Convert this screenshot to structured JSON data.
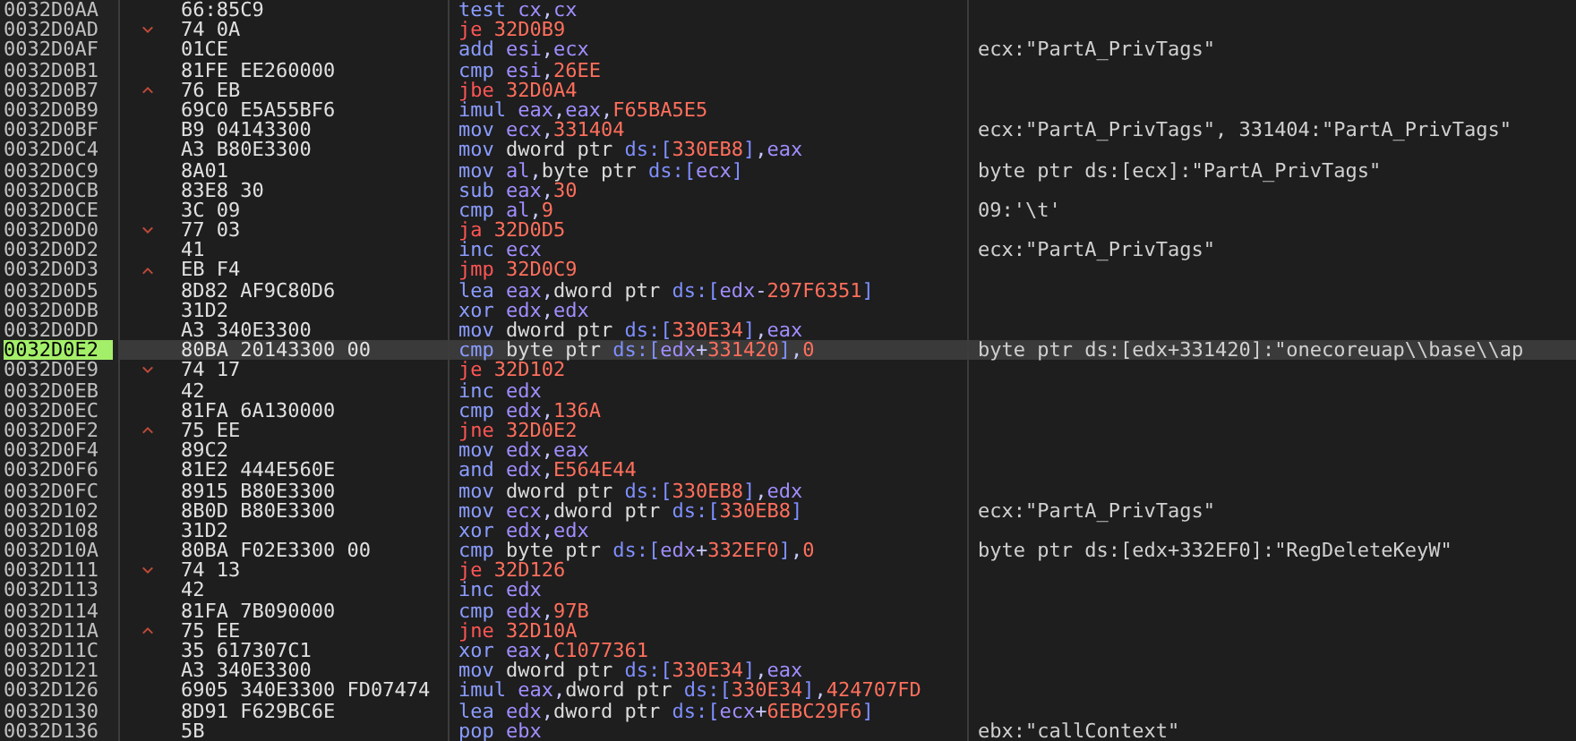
{
  "rows": [
    {
      "address": "0032D0AA",
      "kind": "plain",
      "bytes": "66:85C9",
      "mnemonic": "test",
      "operands": [
        {
          "text": "cx",
          "kind": "register"
        },
        {
          "text": ",",
          "kind": "punct"
        },
        {
          "text": "cx",
          "kind": "register"
        }
      ],
      "selected": false
    },
    {
      "address": "0032D0AD",
      "kind": "jump_down",
      "bytes": "74 0A",
      "mnemonic": "je",
      "operands": [
        {
          "text": "32D0B9",
          "kind": "number"
        }
      ],
      "selected": false
    },
    {
      "address": "0032D0AF",
      "kind": "plain",
      "bytes": "01CE",
      "mnemonic": "add",
      "operands": [
        {
          "text": "esi",
          "kind": "register"
        },
        {
          "text": ",",
          "kind": "punct"
        },
        {
          "text": "ecx",
          "kind": "register"
        }
      ],
      "comment": "ecx:\"PartA_PrivTags\"",
      "selected": false
    },
    {
      "address": "0032D0B1",
      "kind": "plain",
      "bytes": "81FE EE260000",
      "mnemonic": "cmp",
      "operands": [
        {
          "text": "esi",
          "kind": "register"
        },
        {
          "text": ",",
          "kind": "punct"
        },
        {
          "text": "26EE",
          "kind": "number"
        }
      ],
      "selected": false
    },
    {
      "address": "0032D0B7",
      "kind": "jump_up",
      "bytes": "76 EB",
      "mnemonic": "jbe",
      "operands": [
        {
          "text": "32D0A4",
          "kind": "number"
        }
      ],
      "selected": false
    },
    {
      "address": "0032D0B9",
      "kind": "plain",
      "bytes": "69C0 E5A55BF6",
      "mnemonic": "imul",
      "operands": [
        {
          "text": "eax",
          "kind": "register"
        },
        {
          "text": ",",
          "kind": "punct"
        },
        {
          "text": "eax",
          "kind": "register"
        },
        {
          "text": ",",
          "kind": "punct"
        },
        {
          "text": "F65BA5E5",
          "kind": "number"
        }
      ],
      "selected": false
    },
    {
      "address": "0032D0BF",
      "kind": "plain",
      "bytes": "B9 04143300",
      "mnemonic": "mov",
      "operands": [
        {
          "text": "ecx",
          "kind": "register"
        },
        {
          "text": ",",
          "kind": "punct"
        },
        {
          "text": "331404",
          "kind": "number"
        }
      ],
      "comment": "ecx:\"PartA_PrivTags\", 331404:\"PartA_PrivTags\"",
      "selected": false
    },
    {
      "address": "0032D0C4",
      "kind": "plain",
      "bytes": "A3 B80E3300",
      "mnemonic": "mov",
      "operands": [
        {
          "text": "dword ptr ",
          "kind": "size"
        },
        {
          "text": "ds:",
          "kind": "segment"
        },
        {
          "text": "[",
          "kind": "segment"
        },
        {
          "text": "330EB8",
          "kind": "number"
        },
        {
          "text": "]",
          "kind": "segment"
        },
        {
          "text": ",",
          "kind": "punct"
        },
        {
          "text": "eax",
          "kind": "register"
        }
      ],
      "selected": false
    },
    {
      "address": "0032D0C9",
      "kind": "plain",
      "bytes": "8A01",
      "mnemonic": "mov",
      "operands": [
        {
          "text": "al",
          "kind": "register"
        },
        {
          "text": ",",
          "kind": "punct"
        },
        {
          "text": "byte ptr ",
          "kind": "size"
        },
        {
          "text": "ds:",
          "kind": "segment"
        },
        {
          "text": "[",
          "kind": "segment"
        },
        {
          "text": "ecx",
          "kind": "register"
        },
        {
          "text": "]",
          "kind": "segment"
        }
      ],
      "comment": "byte ptr ds:[ecx]:\"PartA_PrivTags\"",
      "selected": false
    },
    {
      "address": "0032D0CB",
      "kind": "plain",
      "bytes": "83E8 30",
      "mnemonic": "sub",
      "operands": [
        {
          "text": "eax",
          "kind": "register"
        },
        {
          "text": ",",
          "kind": "punct"
        },
        {
          "text": "30",
          "kind": "number"
        }
      ],
      "selected": false
    },
    {
      "address": "0032D0CE",
      "kind": "plain",
      "bytes": "3C 09",
      "mnemonic": "cmp",
      "operands": [
        {
          "text": "al",
          "kind": "register"
        },
        {
          "text": ",",
          "kind": "punct"
        },
        {
          "text": "9",
          "kind": "number"
        }
      ],
      "comment": "09:'\\t'",
      "selected": false
    },
    {
      "address": "0032D0D0",
      "kind": "jump_down",
      "bytes": "77 03",
      "mnemonic": "ja",
      "operands": [
        {
          "text": "32D0D5",
          "kind": "number"
        }
      ],
      "selected": false
    },
    {
      "address": "0032D0D2",
      "kind": "plain",
      "bytes": "41",
      "mnemonic": "inc",
      "operands": [
        {
          "text": "ecx",
          "kind": "register"
        }
      ],
      "comment": "ecx:\"PartA_PrivTags\"",
      "selected": false
    },
    {
      "address": "0032D0D3",
      "kind": "jump_up",
      "bytes": "EB F4",
      "mnemonic": "jmp",
      "operands": [
        {
          "text": "32D0C9",
          "kind": "number"
        }
      ],
      "selected": false
    },
    {
      "address": "0032D0D5",
      "kind": "plain",
      "bytes": "8D82 AF9C80D6",
      "mnemonic": "lea",
      "operands": [
        {
          "text": "eax",
          "kind": "register"
        },
        {
          "text": ",",
          "kind": "punct"
        },
        {
          "text": "dword ptr ",
          "kind": "size"
        },
        {
          "text": "ds:",
          "kind": "segment"
        },
        {
          "text": "[",
          "kind": "segment"
        },
        {
          "text": "edx",
          "kind": "register"
        },
        {
          "text": "-",
          "kind": "punct"
        },
        {
          "text": "297F6351",
          "kind": "number"
        },
        {
          "text": "]",
          "kind": "segment"
        }
      ],
      "selected": false
    },
    {
      "address": "0032D0DB",
      "kind": "plain",
      "bytes": "31D2",
      "mnemonic": "xor",
      "operands": [
        {
          "text": "edx",
          "kind": "register"
        },
        {
          "text": ",",
          "kind": "punct"
        },
        {
          "text": "edx",
          "kind": "register"
        }
      ],
      "selected": false
    },
    {
      "address": "0032D0DD",
      "kind": "plain",
      "bytes": "A3 340E3300",
      "mnemonic": "mov",
      "operands": [
        {
          "text": "dword ptr ",
          "kind": "size"
        },
        {
          "text": "ds:",
          "kind": "segment"
        },
        {
          "text": "[",
          "kind": "segment"
        },
        {
          "text": "330E34",
          "kind": "number"
        },
        {
          "text": "]",
          "kind": "segment"
        },
        {
          "text": ",",
          "kind": "punct"
        },
        {
          "text": "eax",
          "kind": "register"
        }
      ],
      "selected": false
    },
    {
      "address": "0032D0E2",
      "kind": "plain",
      "bytes": "80BA 20143300 00",
      "mnemonic": "cmp",
      "operands": [
        {
          "text": "byte ptr ",
          "kind": "size"
        },
        {
          "text": "ds:",
          "kind": "segment"
        },
        {
          "text": "[",
          "kind": "segment"
        },
        {
          "text": "edx",
          "kind": "register"
        },
        {
          "text": "+",
          "kind": "punct"
        },
        {
          "text": "331420",
          "kind": "number"
        },
        {
          "text": "]",
          "kind": "segment"
        },
        {
          "text": ",",
          "kind": "punct"
        },
        {
          "text": "0",
          "kind": "number"
        }
      ],
      "comment": "byte ptr ds:[edx+331420]:\"onecoreuap\\\\base\\\\ap",
      "selected": true
    },
    {
      "address": "0032D0E9",
      "kind": "jump_down",
      "bytes": "74 17",
      "mnemonic": "je",
      "operands": [
        {
          "text": "32D102",
          "kind": "number"
        }
      ],
      "selected": false
    },
    {
      "address": "0032D0EB",
      "kind": "plain",
      "bytes": "42",
      "mnemonic": "inc",
      "operands": [
        {
          "text": "edx",
          "kind": "register"
        }
      ],
      "selected": false
    },
    {
      "address": "0032D0EC",
      "kind": "plain",
      "bytes": "81FA 6A130000",
      "mnemonic": "cmp",
      "operands": [
        {
          "text": "edx",
          "kind": "register"
        },
        {
          "text": ",",
          "kind": "punct"
        },
        {
          "text": "136A",
          "kind": "number"
        }
      ],
      "selected": false
    },
    {
      "address": "0032D0F2",
      "kind": "jump_up",
      "bytes": "75 EE",
      "mnemonic": "jne",
      "operands": [
        {
          "text": "32D0E2",
          "kind": "number"
        }
      ],
      "selected": false
    },
    {
      "address": "0032D0F4",
      "kind": "plain",
      "bytes": "89C2",
      "mnemonic": "mov",
      "operands": [
        {
          "text": "edx",
          "kind": "register"
        },
        {
          "text": ",",
          "kind": "punct"
        },
        {
          "text": "eax",
          "kind": "register"
        }
      ],
      "selected": false
    },
    {
      "address": "0032D0F6",
      "kind": "plain",
      "bytes": "81E2 444E560E",
      "mnemonic": "and",
      "operands": [
        {
          "text": "edx",
          "kind": "register"
        },
        {
          "text": ",",
          "kind": "punct"
        },
        {
          "text": "E564E44",
          "kind": "number"
        }
      ],
      "selected": false
    },
    {
      "address": "0032D0FC",
      "kind": "plain",
      "bytes": "8915 B80E3300",
      "mnemonic": "mov",
      "operands": [
        {
          "text": "dword ptr ",
          "kind": "size"
        },
        {
          "text": "ds:",
          "kind": "segment"
        },
        {
          "text": "[",
          "kind": "segment"
        },
        {
          "text": "330EB8",
          "kind": "number"
        },
        {
          "text": "]",
          "kind": "segment"
        },
        {
          "text": ",",
          "kind": "punct"
        },
        {
          "text": "edx",
          "kind": "register"
        }
      ],
      "selected": false
    },
    {
      "address": "0032D102",
      "kind": "plain",
      "bytes": "8B0D B80E3300",
      "mnemonic": "mov",
      "operands": [
        {
          "text": "ecx",
          "kind": "register"
        },
        {
          "text": ",",
          "kind": "punct"
        },
        {
          "text": "dword ptr ",
          "kind": "size"
        },
        {
          "text": "ds:",
          "kind": "segment"
        },
        {
          "text": "[",
          "kind": "segment"
        },
        {
          "text": "330EB8",
          "kind": "number"
        },
        {
          "text": "]",
          "kind": "segment"
        }
      ],
      "comment": "ecx:\"PartA_PrivTags\"",
      "selected": false
    },
    {
      "address": "0032D108",
      "kind": "plain",
      "bytes": "31D2",
      "mnemonic": "xor",
      "operands": [
        {
          "text": "edx",
          "kind": "register"
        },
        {
          "text": ",",
          "kind": "punct"
        },
        {
          "text": "edx",
          "kind": "register"
        }
      ],
      "selected": false
    },
    {
      "address": "0032D10A",
      "kind": "plain",
      "bytes": "80BA F02E3300 00",
      "mnemonic": "cmp",
      "operands": [
        {
          "text": "byte ptr ",
          "kind": "size"
        },
        {
          "text": "ds:",
          "kind": "segment"
        },
        {
          "text": "[",
          "kind": "segment"
        },
        {
          "text": "edx",
          "kind": "register"
        },
        {
          "text": "+",
          "kind": "punct"
        },
        {
          "text": "332EF0",
          "kind": "number"
        },
        {
          "text": "]",
          "kind": "segment"
        },
        {
          "text": ",",
          "kind": "punct"
        },
        {
          "text": "0",
          "kind": "number"
        }
      ],
      "comment": "byte ptr ds:[edx+332EF0]:\"RegDeleteKeyW\"",
      "selected": false
    },
    {
      "address": "0032D111",
      "kind": "jump_down",
      "bytes": "74 13",
      "mnemonic": "je",
      "operands": [
        {
          "text": "32D126",
          "kind": "number"
        }
      ],
      "selected": false
    },
    {
      "address": "0032D113",
      "kind": "plain",
      "bytes": "42",
      "mnemonic": "inc",
      "operands": [
        {
          "text": "edx",
          "kind": "register"
        }
      ],
      "selected": false
    },
    {
      "address": "0032D114",
      "kind": "plain",
      "bytes": "81FA 7B090000",
      "mnemonic": "cmp",
      "operands": [
        {
          "text": "edx",
          "kind": "register"
        },
        {
          "text": ",",
          "kind": "punct"
        },
        {
          "text": "97B",
          "kind": "number"
        }
      ],
      "selected": false
    },
    {
      "address": "0032D11A",
      "kind": "jump_up",
      "bytes": "75 EE",
      "mnemonic": "jne",
      "operands": [
        {
          "text": "32D10A",
          "kind": "number"
        }
      ],
      "selected": false
    },
    {
      "address": "0032D11C",
      "kind": "plain",
      "bytes": "35 617307C1",
      "mnemonic": "xor",
      "operands": [
        {
          "text": "eax",
          "kind": "register"
        },
        {
          "text": ",",
          "kind": "punct"
        },
        {
          "text": "C1077361",
          "kind": "number"
        }
      ],
      "selected": false
    },
    {
      "address": "0032D121",
      "kind": "plain",
      "bytes": "A3 340E3300",
      "mnemonic": "mov",
      "operands": [
        {
          "text": "dword ptr ",
          "kind": "size"
        },
        {
          "text": "ds:",
          "kind": "segment"
        },
        {
          "text": "[",
          "kind": "segment"
        },
        {
          "text": "330E34",
          "kind": "number"
        },
        {
          "text": "]",
          "kind": "segment"
        },
        {
          "text": ",",
          "kind": "punct"
        },
        {
          "text": "eax",
          "kind": "register"
        }
      ],
      "selected": false
    },
    {
      "address": "0032D126",
      "kind": "plain",
      "bytes": "6905 340E3300 FD07474",
      "mnemonic": "imul",
      "operands": [
        {
          "text": "eax",
          "kind": "register"
        },
        {
          "text": ",",
          "kind": "punct"
        },
        {
          "text": "dword ptr ",
          "kind": "size"
        },
        {
          "text": "ds:",
          "kind": "segment"
        },
        {
          "text": "[",
          "kind": "segment"
        },
        {
          "text": "330E34",
          "kind": "number"
        },
        {
          "text": "]",
          "kind": "segment"
        },
        {
          "text": ",",
          "kind": "punct"
        },
        {
          "text": "424707FD",
          "kind": "number"
        }
      ],
      "selected": false
    },
    {
      "address": "0032D130",
      "kind": "plain",
      "bytes": "8D91 F629BC6E",
      "mnemonic": "lea",
      "operands": [
        {
          "text": "edx",
          "kind": "register"
        },
        {
          "text": ",",
          "kind": "punct"
        },
        {
          "text": "dword ptr ",
          "kind": "size"
        },
        {
          "text": "ds:",
          "kind": "segment"
        },
        {
          "text": "[",
          "kind": "segment"
        },
        {
          "text": "ecx",
          "kind": "register"
        },
        {
          "text": "+",
          "kind": "punct"
        },
        {
          "text": "6EBC29F6",
          "kind": "number"
        },
        {
          "text": "]",
          "kind": "segment"
        }
      ],
      "selected": false
    },
    {
      "address": "0032D136",
      "kind": "plain",
      "bytes": "5B",
      "mnemonic": "pop",
      "operands": [
        {
          "text": "ebx",
          "kind": "register"
        }
      ],
      "comment": "ebx:\"callContext\"",
      "selected": false
    }
  ]
}
